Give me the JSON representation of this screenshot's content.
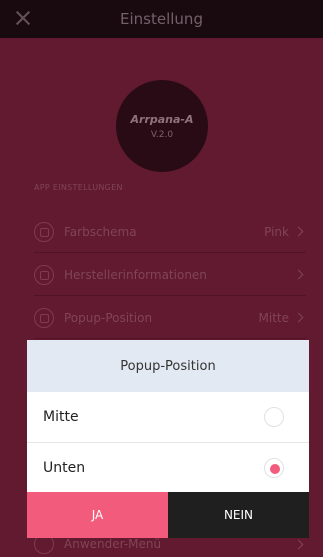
{
  "titlebar": {
    "title": "Einstellung"
  },
  "logo": {
    "name": "Arrpana-A",
    "version": "V.2.0"
  },
  "settings": {
    "section_label": "APP EINSTELLUNGEN",
    "items": [
      {
        "label": "Farbschema",
        "value": "Pink"
      },
      {
        "label": "Herstellerinformationen",
        "value": ""
      },
      {
        "label": "Popup-Position",
        "value": "Mitte"
      },
      {
        "label": "Anwender-Menü",
        "value": ""
      }
    ]
  },
  "dialog": {
    "title": "Popup-Position",
    "options": [
      {
        "label": "Mitte",
        "selected": false
      },
      {
        "label": "Unten",
        "selected": true
      }
    ],
    "yes_label": "JA",
    "no_label": "NEIN"
  },
  "colors": {
    "accent": "#f25b7b",
    "background": "#6a1d33",
    "titlebar": "#1c0b12"
  }
}
